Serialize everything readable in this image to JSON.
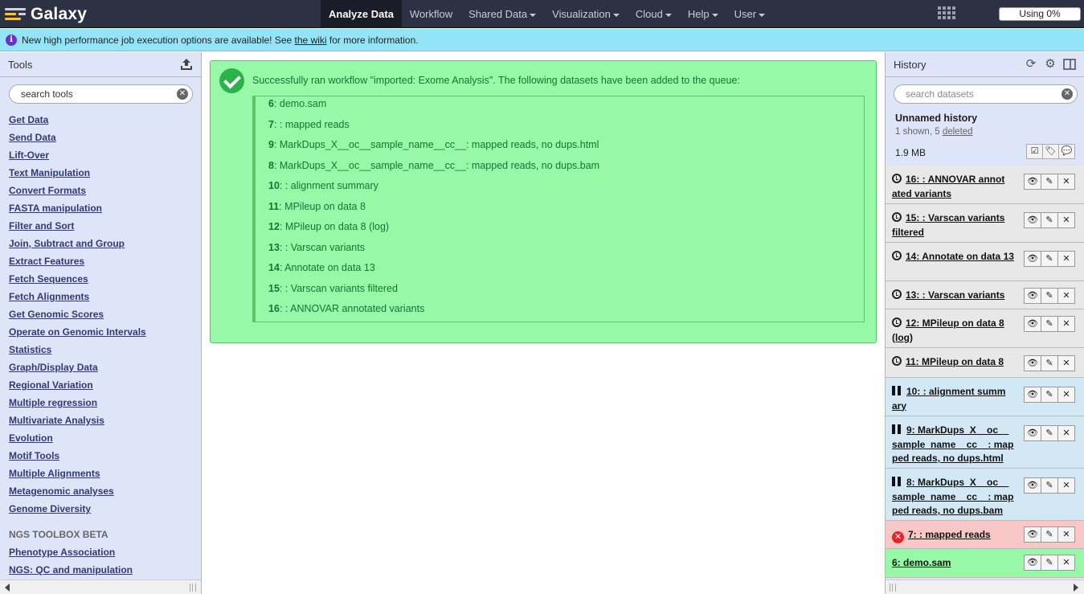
{
  "masthead": {
    "brand": "Galaxy",
    "nav": [
      {
        "label": "Analyze Data",
        "active": true,
        "dropdown": false
      },
      {
        "label": "Workflow",
        "active": false,
        "dropdown": false
      },
      {
        "label": "Shared Data",
        "active": false,
        "dropdown": true
      },
      {
        "label": "Visualization",
        "active": false,
        "dropdown": true
      },
      {
        "label": "Cloud",
        "active": false,
        "dropdown": true
      },
      {
        "label": "Help",
        "active": false,
        "dropdown": true
      },
      {
        "label": "User",
        "active": false,
        "dropdown": true
      }
    ],
    "quota": "Using 0%"
  },
  "message": {
    "text_before": "New high performance job execution options are available! See ",
    "link": "the wiki",
    "text_after": " for more information."
  },
  "tools": {
    "title": "Tools",
    "search_placeholder": "search tools",
    "items": [
      "Get Data",
      "Send Data",
      "Lift-Over",
      "Text Manipulation",
      "Convert Formats",
      "FASTA manipulation",
      "Filter and Sort",
      "Join, Subtract and Group",
      "Extract Features",
      "Fetch Sequences",
      "Fetch Alignments",
      "Get Genomic Scores",
      "Operate on Genomic Intervals",
      "Statistics",
      "Graph/Display Data",
      "Regional Variation",
      "Multiple regression",
      "Multivariate Analysis",
      "Evolution",
      "Motif Tools",
      "Multiple Alignments",
      "Metagenomic analyses",
      "Genome Diversity"
    ],
    "section_label": "NGS TOOLBOX BETA",
    "section_items": [
      "Phenotype Association",
      "NGS: QC and manipulation"
    ]
  },
  "center": {
    "message": "Successfully ran workflow \"imported: Exome Analysis\". The following datasets have been added to the queue:",
    "datasets": [
      {
        "num": "6",
        "name": ": demo.sam"
      },
      {
        "num": "7",
        "name": ": : mapped reads"
      },
      {
        "num": "9",
        "name": ": MarkDups_X__oc__sample_name__cc__: mapped reads, no dups.html"
      },
      {
        "num": "8",
        "name": ": MarkDups_X__oc__sample_name__cc__: mapped reads, no dups.bam"
      },
      {
        "num": "10",
        "name": ": : alignment summary"
      },
      {
        "num": "11",
        "name": ": MPileup on data 8"
      },
      {
        "num": "12",
        "name": ": MPileup on data 8 (log)"
      },
      {
        "num": "13",
        "name": ": : Varscan variants"
      },
      {
        "num": "14",
        "name": ": Annotate on data 13"
      },
      {
        "num": "15",
        "name": ": : Varscan variants filtered"
      },
      {
        "num": "16",
        "name": ": : ANNOVAR annotated variants"
      }
    ]
  },
  "history": {
    "title": "History",
    "search_placeholder": "search datasets",
    "name": "Unnamed history",
    "shown_text": "1 shown, 5 ",
    "deleted_link": "deleted",
    "size": "1.9 MB",
    "datasets": [
      {
        "title": "16: : ANNOVAR annot ated variants",
        "state": "queued"
      },
      {
        "title": "15: : Varscan variants filtered",
        "state": "queued"
      },
      {
        "title": "14: Annotate on data 13",
        "state": "queued"
      },
      {
        "title": "13: : Varscan variants",
        "state": "queued"
      },
      {
        "title": "12: MPileup on data 8 (log)",
        "state": "queued"
      },
      {
        "title": "11: MPileup on data 8",
        "state": "queued"
      },
      {
        "title": "10: : alignment summ ary",
        "state": "paused"
      },
      {
        "title": "9: MarkDups_X__oc__ sample_name__cc__: map ped reads, no dups.html",
        "state": "paused"
      },
      {
        "title": "8: MarkDups_X__oc__ sample_name__cc__: map ped reads, no dups.bam",
        "state": "paused"
      },
      {
        "title": "7: : mapped reads",
        "state": "error"
      },
      {
        "title": "6: demo.sam",
        "state": "ok"
      }
    ]
  },
  "colors": {
    "masthead": "#2c3143",
    "message_bar": "#94e4f8",
    "panel_bg": "#dfe5f9",
    "ok": "#97f8a8",
    "paused": "#d2e8f4",
    "error": "#f9c7c5",
    "queued": "#e8e8e8"
  }
}
